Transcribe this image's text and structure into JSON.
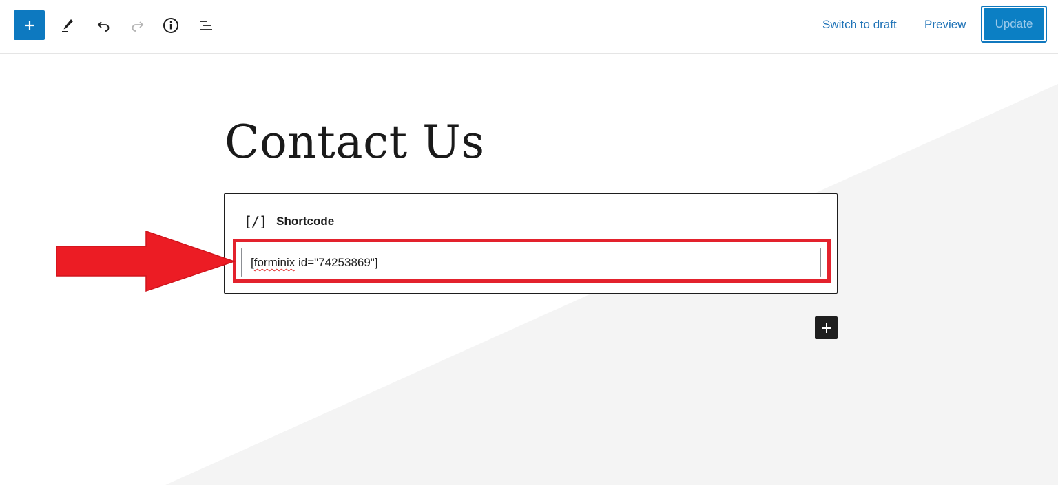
{
  "toolbar": {
    "add_block_icon": "plus-icon",
    "tools_icon": "pencil-icon",
    "undo_icon": "undo-icon",
    "redo_icon": "redo-icon",
    "details_icon": "info-icon",
    "list_view_icon": "list-view-icon",
    "switch_to_draft_label": "Switch to draft",
    "preview_label": "Preview",
    "update_label": "Update"
  },
  "editor": {
    "post_title": "Contact Us",
    "shortcode_block": {
      "icon_text": "[/]",
      "label": "Shortcode",
      "value_prefix": "[",
      "value_spellchecked_word": "forminix",
      "value_suffix": " id=\"74253869\"]"
    },
    "add_block_after_icon": "plus-icon"
  },
  "annotation": {
    "arrow_color": "#e3222d",
    "highlight_color": "#e3222d"
  },
  "colors": {
    "accent": "#0d79c0",
    "link": "#1f73b7",
    "background_shape": "#f5f5f5"
  }
}
